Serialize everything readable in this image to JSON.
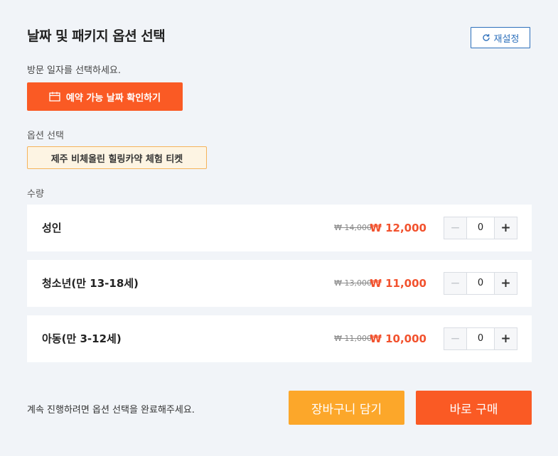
{
  "header": {
    "title": "날짜 및 패키지 옵션 선택",
    "reset_label": "재설정"
  },
  "visit": {
    "label": "방문 일자를 선택하세요.",
    "date_button_label": "예약 가능 날짜 확인하기"
  },
  "option": {
    "label": "옵션 선택",
    "selected": "제주 비체올린 힐링카약 체험 티켓"
  },
  "quantity": {
    "label": "수량",
    "rows": [
      {
        "name": "성인",
        "original_price": "₩ 14,000",
        "sale_price": "₩ 12,000",
        "qty": "0"
      },
      {
        "name": "청소년(만 13-18세)",
        "original_price": "₩ 13,000",
        "sale_price": "₩ 11,000",
        "qty": "0"
      },
      {
        "name": "아동(만 3-12세)",
        "original_price": "₩ 11,000",
        "sale_price": "₩ 10,000",
        "qty": "0"
      }
    ]
  },
  "footer": {
    "note": "계속 진행하려면 옵션 선택을 완료해주세요.",
    "cart_label": "장바구니 담기",
    "buy_label": "바로 구매"
  },
  "colors": {
    "accent": "#fa5a24",
    "cart": "#fca72a",
    "link": "#2c6fbb",
    "price": "#f2522e"
  }
}
